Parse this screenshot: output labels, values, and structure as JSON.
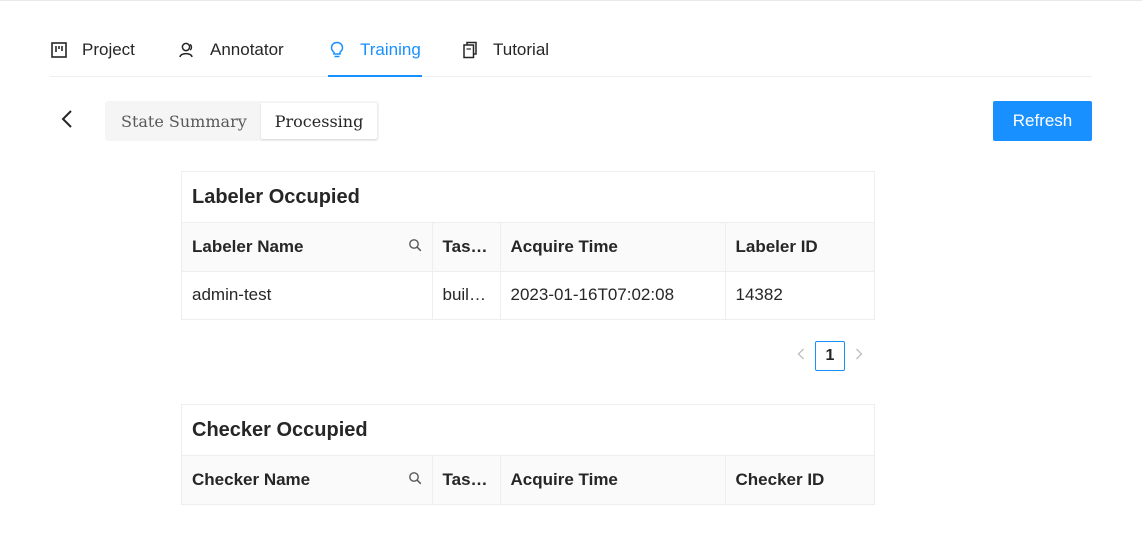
{
  "nav": {
    "tabs": [
      {
        "label": "Project",
        "icon": "project-icon"
      },
      {
        "label": "Annotator",
        "icon": "user-icon"
      },
      {
        "label": "Training",
        "icon": "bulb-icon"
      },
      {
        "label": "Tutorial",
        "icon": "copy-icon"
      }
    ],
    "active_tab": "Training",
    "accent": "#1890ff"
  },
  "toolbar": {
    "back_icon": "chevron-left-icon",
    "segments": [
      "State Summary",
      "Processing"
    ],
    "selected_segment": "Processing",
    "refresh_label": "Refresh"
  },
  "labeler_table": {
    "title": "Labeler Occupied",
    "columns": [
      "Labeler Name",
      "Tas…",
      "Acquire Time",
      "Labeler ID"
    ],
    "rows": [
      [
        "admin-test",
        "buil…",
        "2023-01-16T07:02:08",
        "14382"
      ]
    ],
    "search_icon": "search-icon"
  },
  "pagination": {
    "current_page": "1",
    "prev_icon": "chevron-left-icon",
    "next_icon": "chevron-right-icon"
  },
  "checker_table": {
    "title": "Checker Occupied",
    "columns": [
      "Checker Name",
      "Tas…",
      "Acquire Time",
      "Checker ID"
    ],
    "search_icon": "search-icon"
  }
}
